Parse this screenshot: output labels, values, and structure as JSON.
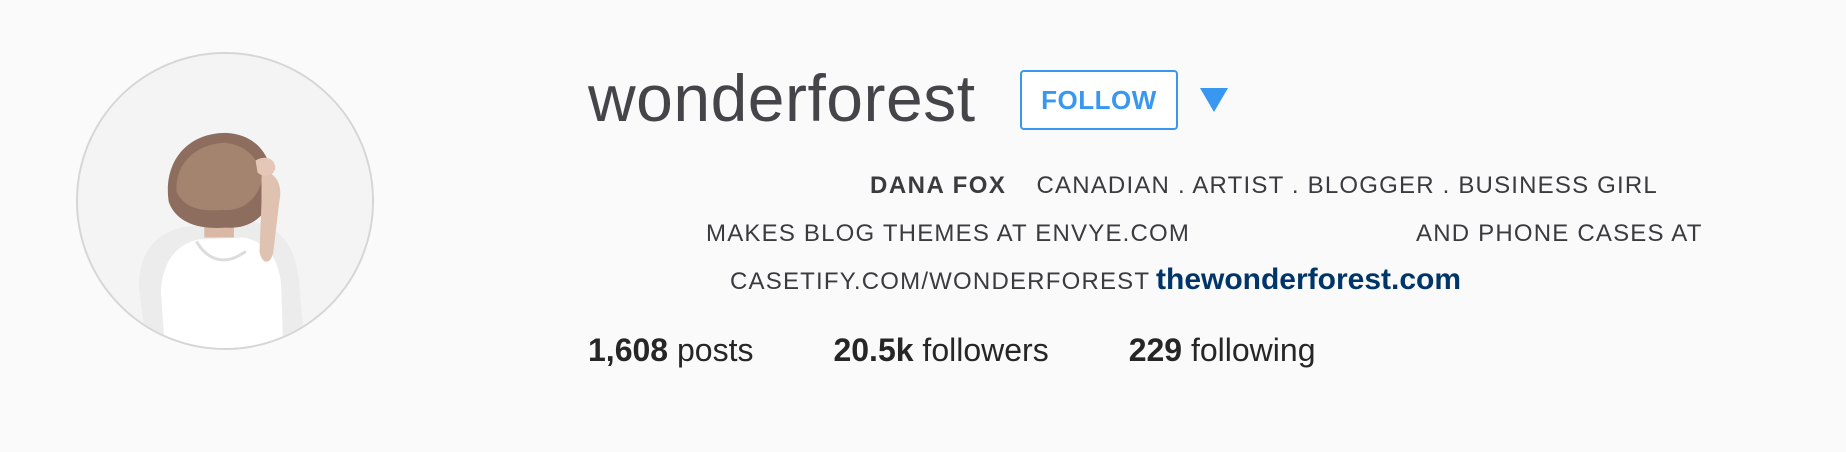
{
  "profile": {
    "username": "wonderforest",
    "follow_label": "FOLLOW",
    "dropdown_icon": "caret-down-icon",
    "avatar_icon": "profile-photo"
  },
  "bio": {
    "name": "DANA FOX",
    "tagline": "CANADIAN . ARTIST . BLOGGER . BUSINESS GIRL",
    "line2_left": "MAKES BLOG THEMES AT ENVYE.COM",
    "line2_right": "AND PHONE CASES AT",
    "line3": "CASETIFY.COM/WONDERFOREST",
    "website": "thewonderforest.com"
  },
  "stats": {
    "posts_count": "1,608",
    "posts_label": "posts",
    "followers_count": "20.5k",
    "followers_label": "followers",
    "following_count": "229",
    "following_label": "following"
  },
  "colors": {
    "accent": "#3897f0",
    "link": "#003569",
    "background": "#fafafa"
  }
}
